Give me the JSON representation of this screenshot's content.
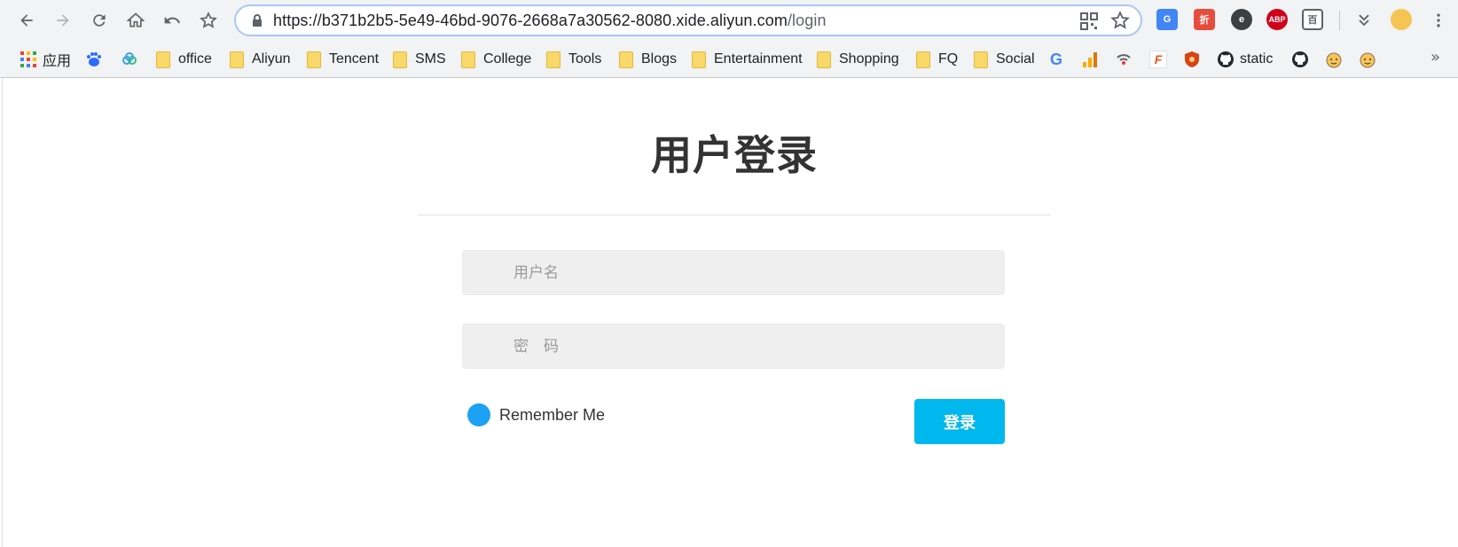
{
  "browser": {
    "url_host": "https://b371b2b5-5e49-46bd-9076-2668a7a30562-8080.xide.aliyun.com",
    "url_path": "/login",
    "extensions": [
      {
        "name": "google-translate-icon",
        "color": "#4285f4",
        "text": "G"
      },
      {
        "name": "zhe-icon",
        "color": "#e84c3d",
        "text": "折"
      },
      {
        "name": "e-icon",
        "color": "#3c4043",
        "text": "e"
      },
      {
        "name": "adblock-plus-icon",
        "color": "#d0021b",
        "text": "ABP"
      },
      {
        "name": "reader-icon",
        "color": "#5f6368",
        "text": "百"
      }
    ]
  },
  "bookmarks": {
    "apps_label": "应用",
    "folders": [
      "office",
      "Aliyun",
      "Tencent",
      "SMS",
      "College",
      "Tools",
      "Blogs",
      "Entertainment",
      "Shopping",
      "FQ",
      "Social"
    ],
    "static_label": "static",
    "more": "»"
  },
  "login": {
    "title": "用户登录",
    "username_placeholder": "用户名",
    "password_placeholder": "密　码",
    "remember_label": "Remember Me",
    "submit_label": "登录"
  },
  "colors": {
    "accent": "#00b7ee",
    "radio": "#1da1f2",
    "title": "#333333"
  }
}
